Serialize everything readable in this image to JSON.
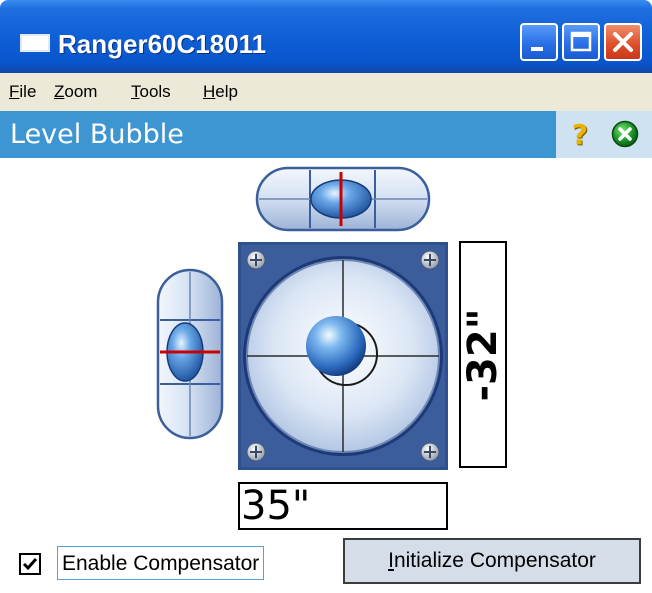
{
  "window": {
    "title": "Ranger60C18011",
    "buttons": [
      "minimize",
      "maximize",
      "close"
    ]
  },
  "menu": [
    {
      "label_first": "F",
      "label_rest": "ile"
    },
    {
      "label_first": "Z",
      "label_rest": "oom"
    },
    {
      "label_first": "T",
      "label_rest": "ools"
    },
    {
      "label_first": "H",
      "label_rest": "elp"
    }
  ],
  "header": {
    "title": "Level Bubble",
    "help_glyph": "?",
    "icons": [
      "help-icon",
      "ok-icon"
    ]
  },
  "level": {
    "vertical_readout": "-32\"",
    "horizontal_readout": "35\""
  },
  "controls": {
    "compensator_checkbox_checked": true,
    "compensator_label": "Enable Compensator",
    "init_button_first": "I",
    "init_button_rest": "nitialize Compensator"
  },
  "colors": {
    "titlebar": "#0f5fd6",
    "header": "#3d95d1",
    "menubar": "#ece9d8",
    "bubble": "#2f6fb8",
    "level_frame": "#2f4f8f"
  }
}
